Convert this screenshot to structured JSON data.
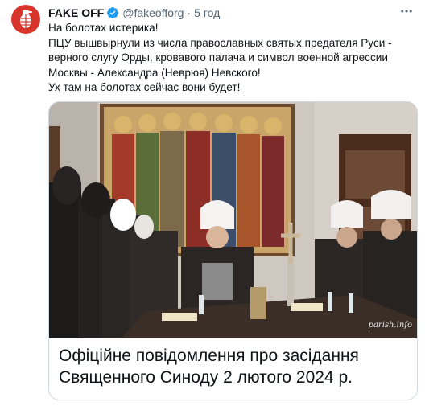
{
  "tweet": {
    "display_name": "FAKE OFF",
    "handle": "@fakeofforg",
    "separator": "·",
    "time": "5 год",
    "more_icon": "more-horizontal-icon",
    "verified_icon": "verified-badge-icon",
    "text": "На болотах истерика!\nПЦУ вышвырнули из числа православных святых предателя Руси - верного слугу Орды, кровавого палача и символ военной агрессии Москвы -  Александра (Неврюя) Невского!\nУх там на болотах сейчас вони будет!"
  },
  "card": {
    "title": "Офіційне повідомлення про засідання\nСвященного Синоду 2 лютого 2024 р.",
    "image_watermark": "parish.info"
  },
  "colors": {
    "avatar_bg": "#d9342b",
    "verified": "#1d9bf0",
    "secondary_text": "#536471",
    "border": "#cfd9de"
  }
}
